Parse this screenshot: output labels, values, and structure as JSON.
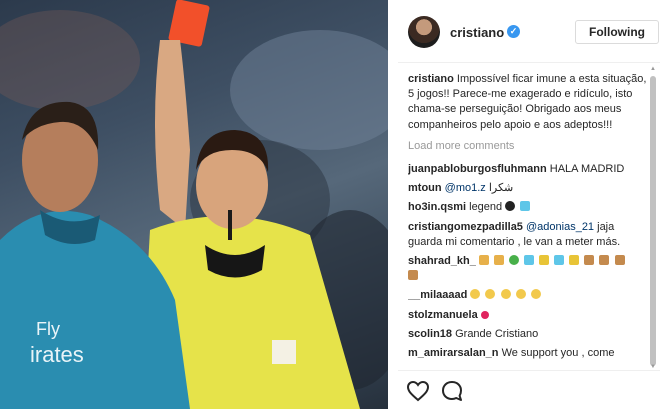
{
  "header": {
    "username": "cristiano",
    "follow_label": "Following"
  },
  "caption": {
    "username": "cristiano",
    "text": "Impossível ficar imune a esta situação, 5 jogos!! Parece-me exagerado e ridículo, isto chama-se perseguição! Obrigado aos meus companheiros pelo apoio e aos adeptos!!!"
  },
  "load_more": "Load more comments",
  "comments": [
    {
      "username": "juanpabloburgosfluhmann",
      "mention": "",
      "text": "HALA MADRID"
    },
    {
      "username": "mtoun",
      "mention": "@mo1.z",
      "text": "شكرا"
    },
    {
      "username": "ho3in.qsmi",
      "mention": "",
      "text": "legend"
    },
    {
      "username": "cristiangomezpadilla5",
      "mention": "@adonias_21",
      "text": "jaja guarda mi comentario , le van a meter más."
    },
    {
      "username": "shahrad_kh_",
      "mention": "",
      "text": ""
    },
    {
      "username": "__milaaaad",
      "mention": "",
      "text": ""
    },
    {
      "username": "stolzmanuela",
      "mention": "",
      "text": ""
    },
    {
      "username": "scolin18",
      "mention": "",
      "text": "Grande Cristiano"
    },
    {
      "username": "m_amirarsalan_n",
      "mention": "",
      "text": "We support you , come"
    }
  ],
  "icons": [
    "heart-icon",
    "comment-icon"
  ],
  "colors": {
    "verified": "#3897f0",
    "mention": "#003569",
    "muted": "#999999"
  }
}
